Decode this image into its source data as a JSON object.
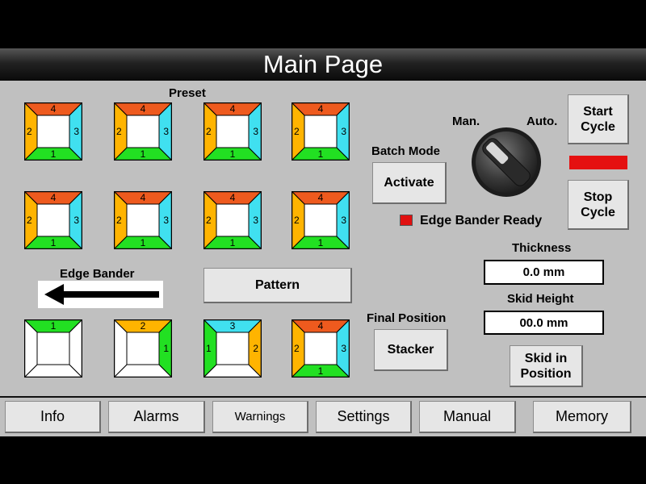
{
  "title": "Main Page",
  "preset": {
    "label": "Preset",
    "tile_numbers": {
      "top": "4",
      "left": "2",
      "right": "3",
      "bottom": "1"
    }
  },
  "colors": {
    "top": "#ee5a1e",
    "left": "#ffb400",
    "right": "#40e0f0",
    "bottom": "#22e022",
    "ready_indicator": "#e01010"
  },
  "edge_bander": {
    "label": "Edge Bander"
  },
  "pattern": {
    "button": "Pattern",
    "tiles": [
      "1",
      "2",
      "3",
      "4"
    ]
  },
  "batch_mode": {
    "label": "Batch Mode",
    "button": "Activate"
  },
  "final_position": {
    "label": "Final Position",
    "button": "Stacker"
  },
  "selector": {
    "manual_label": "Man.",
    "auto_label": "Auto.",
    "position": "Auto."
  },
  "cycle": {
    "start_button": "Start\nCycle",
    "stop_button": "Stop\nCycle"
  },
  "status": {
    "edge_bander_ready": "Edge Bander Ready"
  },
  "thickness": {
    "label": "Thickness",
    "value": "0.0 mm"
  },
  "skid_height": {
    "label": "Skid Height",
    "value": "00.0 mm"
  },
  "skid_in_position": {
    "button": "Skid in\nPosition"
  },
  "nav": {
    "info": "Info",
    "alarms": "Alarms",
    "warnings": "Warnings",
    "settings": "Settings",
    "manual": "Manual",
    "memory": "Memory"
  }
}
